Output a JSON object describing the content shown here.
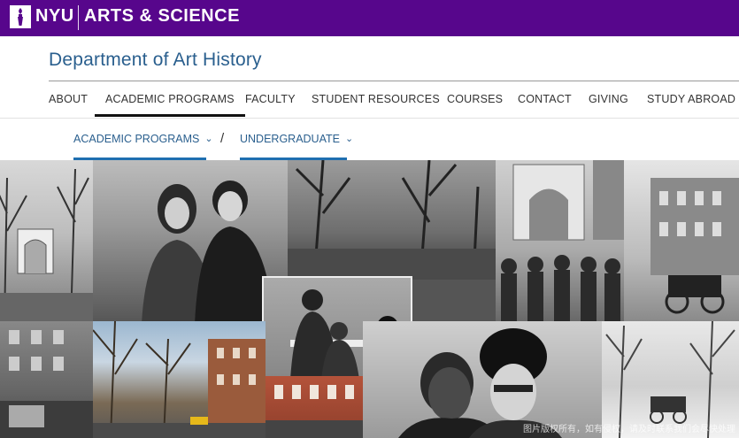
{
  "header": {
    "logo_text": "NYU",
    "school": "ARTS & SCIENCE",
    "brand_color": "#57068c"
  },
  "department": {
    "title": "Department of Art History",
    "title_color": "#2a5f8e"
  },
  "nav": {
    "items": [
      {
        "label": "ABOUT"
      },
      {
        "label": "ACADEMIC PROGRAMS",
        "active": true
      },
      {
        "label": "FACULTY"
      },
      {
        "label": "STUDENT RESOURCES"
      },
      {
        "label": "COURSES"
      },
      {
        "label": "CONTACT"
      },
      {
        "label": "GIVING"
      },
      {
        "label": "STUDY ABROAD"
      }
    ]
  },
  "breadcrumb": {
    "items": [
      {
        "label": "ACADEMIC PROGRAMS"
      },
      {
        "label": "UNDERGRADUATE"
      }
    ],
    "separator": "/",
    "underline_color": "#1f6fb0"
  },
  "hero": {
    "watermark": "图片版权所有，如有侵权，请及时联系我们会尽快处理"
  },
  "icons": {
    "logo": "nyu-torch-icon",
    "chevron": "chevron-down-icon"
  }
}
